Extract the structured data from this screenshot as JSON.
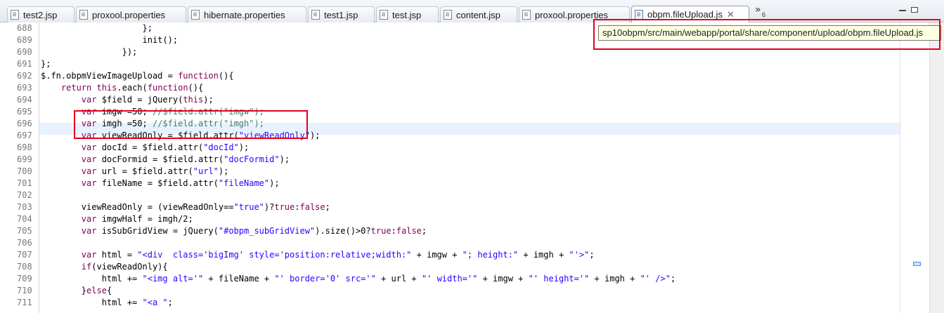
{
  "tabs": [
    {
      "label": "test2.jsp",
      "icon": "jsp-file-icon"
    },
    {
      "label": "proxool.properties",
      "icon": "properties-file-icon"
    },
    {
      "label": "hibernate.properties",
      "icon": "properties-file-icon"
    },
    {
      "label": "test1.jsp",
      "icon": "jsp-file-icon"
    },
    {
      "label": "test.jsp",
      "icon": "jsp-file-icon"
    },
    {
      "label": "content.jsp",
      "icon": "jsp-file-icon"
    },
    {
      "label": "proxool.properties",
      "icon": "properties-file-icon"
    },
    {
      "label": "obpm.fileUpload.js",
      "icon": "js-file-icon",
      "active": true,
      "close": "✕"
    }
  ],
  "tabs_overflow": {
    "chevron": "»",
    "count": "6"
  },
  "tooltip": {
    "text": "sp10obpm/src/main/webapp/portal/share/component/upload/obpm.fileUpload.js"
  },
  "editor": {
    "highlighted_line": "696",
    "lines": [
      {
        "num": "688",
        "segments": [
          {
            "t": "                    };",
            "c": "#000000"
          }
        ]
      },
      {
        "num": "689",
        "segments": [
          {
            "t": "                    init();",
            "c": "#000000"
          }
        ]
      },
      {
        "num": "690",
        "segments": [
          {
            "t": "                });",
            "c": "#000000"
          }
        ]
      },
      {
        "num": "691",
        "segments": [
          {
            "t": "};",
            "c": "#000000"
          }
        ]
      },
      {
        "num": "692",
        "segments": [
          {
            "t": "$.fn.obpmViewImageUpload = ",
            "c": "#000000"
          },
          {
            "t": "function",
            "c": "#7f0055"
          },
          {
            "t": "(){",
            "c": "#000000"
          }
        ]
      },
      {
        "num": "693",
        "segments": [
          {
            "t": "    ",
            "c": "#000000"
          },
          {
            "t": "return this",
            "c": "#7f0055"
          },
          {
            "t": ".each(",
            "c": "#000000"
          },
          {
            "t": "function",
            "c": "#7f0055"
          },
          {
            "t": "(){",
            "c": "#000000"
          }
        ]
      },
      {
        "num": "694",
        "segments": [
          {
            "t": "        ",
            "c": "#000000"
          },
          {
            "t": "var",
            "c": "#7f0055"
          },
          {
            "t": " $field = jQuery(",
            "c": "#000000"
          },
          {
            "t": "this",
            "c": "#7f0055"
          },
          {
            "t": ");",
            "c": "#000000"
          }
        ]
      },
      {
        "num": "695",
        "segments": [
          {
            "t": "        ",
            "c": "#000000"
          },
          {
            "t": "var",
            "c": "#7f0055"
          },
          {
            "t": " imgw =50; ",
            "c": "#000000"
          },
          {
            "t": "//$field.attr(\"imgw\");",
            "c": "#3f7f5f"
          }
        ]
      },
      {
        "num": "696",
        "segments": [
          {
            "t": "        ",
            "c": "#000000"
          },
          {
            "t": "var",
            "c": "#7f0055"
          },
          {
            "t": " imgh =50; ",
            "c": "#000000"
          },
          {
            "t": "//$field.attr(\"imgh\");",
            "c": "#3f7f5f"
          }
        ]
      },
      {
        "num": "697",
        "segments": [
          {
            "t": "        ",
            "c": "#000000"
          },
          {
            "t": "var",
            "c": "#7f0055"
          },
          {
            "t": " viewReadOnly = $field.attr(",
            "c": "#000000"
          },
          {
            "t": "\"viewReadOnly\"",
            "c": "#2a00ff"
          },
          {
            "t": ");",
            "c": "#000000"
          }
        ]
      },
      {
        "num": "698",
        "segments": [
          {
            "t": "        ",
            "c": "#000000"
          },
          {
            "t": "var",
            "c": "#7f0055"
          },
          {
            "t": " docId = $field.attr(",
            "c": "#000000"
          },
          {
            "t": "\"docId\"",
            "c": "#2a00ff"
          },
          {
            "t": ");",
            "c": "#000000"
          }
        ]
      },
      {
        "num": "699",
        "segments": [
          {
            "t": "        ",
            "c": "#000000"
          },
          {
            "t": "var",
            "c": "#7f0055"
          },
          {
            "t": " docFormid = $field.attr(",
            "c": "#000000"
          },
          {
            "t": "\"docFormid\"",
            "c": "#2a00ff"
          },
          {
            "t": ");",
            "c": "#000000"
          }
        ]
      },
      {
        "num": "700",
        "segments": [
          {
            "t": "        ",
            "c": "#000000"
          },
          {
            "t": "var",
            "c": "#7f0055"
          },
          {
            "t": " url = $field.attr(",
            "c": "#000000"
          },
          {
            "t": "\"url\"",
            "c": "#2a00ff"
          },
          {
            "t": ");",
            "c": "#000000"
          }
        ]
      },
      {
        "num": "701",
        "segments": [
          {
            "t": "        ",
            "c": "#000000"
          },
          {
            "t": "var",
            "c": "#7f0055"
          },
          {
            "t": " fileName = $field.attr(",
            "c": "#000000"
          },
          {
            "t": "\"fileName\"",
            "c": "#2a00ff"
          },
          {
            "t": ");",
            "c": "#000000"
          }
        ]
      },
      {
        "num": "702",
        "segments": []
      },
      {
        "num": "703",
        "segments": [
          {
            "t": "        viewReadOnly = (viewReadOnly==",
            "c": "#000000"
          },
          {
            "t": "\"true\"",
            "c": "#2a00ff"
          },
          {
            "t": ")?",
            "c": "#000000"
          },
          {
            "t": "true",
            "c": "#7f0055"
          },
          {
            "t": ":",
            "c": "#000000"
          },
          {
            "t": "false",
            "c": "#7f0055"
          },
          {
            "t": ";",
            "c": "#000000"
          }
        ]
      },
      {
        "num": "704",
        "segments": [
          {
            "t": "        ",
            "c": "#000000"
          },
          {
            "t": "var",
            "c": "#7f0055"
          },
          {
            "t": " imgwHalf = imgh/2;",
            "c": "#000000"
          }
        ]
      },
      {
        "num": "705",
        "segments": [
          {
            "t": "        ",
            "c": "#000000"
          },
          {
            "t": "var",
            "c": "#7f0055"
          },
          {
            "t": " isSubGridView = jQuery(",
            "c": "#000000"
          },
          {
            "t": "\"#obpm_subGridView\"",
            "c": "#2a00ff"
          },
          {
            "t": ").size()>0?",
            "c": "#000000"
          },
          {
            "t": "true",
            "c": "#7f0055"
          },
          {
            "t": ":",
            "c": "#000000"
          },
          {
            "t": "false",
            "c": "#7f0055"
          },
          {
            "t": ";",
            "c": "#000000"
          }
        ]
      },
      {
        "num": "706",
        "segments": []
      },
      {
        "num": "707",
        "segments": [
          {
            "t": "        ",
            "c": "#000000"
          },
          {
            "t": "var",
            "c": "#7f0055"
          },
          {
            "t": " html = ",
            "c": "#000000"
          },
          {
            "t": "\"<div  class='bigImg' style='position:relative;width:\"",
            "c": "#2a00ff"
          },
          {
            "t": " + imgw + ",
            "c": "#000000"
          },
          {
            "t": "\"; height:\"",
            "c": "#2a00ff"
          },
          {
            "t": " + imgh + ",
            "c": "#000000"
          },
          {
            "t": "\"'>\"",
            "c": "#2a00ff"
          },
          {
            "t": ";",
            "c": "#000000"
          }
        ]
      },
      {
        "num": "708",
        "segments": [
          {
            "t": "        ",
            "c": "#000000"
          },
          {
            "t": "if",
            "c": "#7f0055"
          },
          {
            "t": "(viewReadOnly){",
            "c": "#000000"
          }
        ]
      },
      {
        "num": "709",
        "segments": [
          {
            "t": "            html += ",
            "c": "#000000"
          },
          {
            "t": "\"<img alt='\"",
            "c": "#2a00ff"
          },
          {
            "t": " + fileName + ",
            "c": "#000000"
          },
          {
            "t": "\"' border='0' src='\"",
            "c": "#2a00ff"
          },
          {
            "t": " + url + ",
            "c": "#000000"
          },
          {
            "t": "\"' width='\"",
            "c": "#2a00ff"
          },
          {
            "t": " + imgw + ",
            "c": "#000000"
          },
          {
            "t": "\"' height='\"",
            "c": "#2a00ff"
          },
          {
            "t": " + imgh + ",
            "c": "#000000"
          },
          {
            "t": "\"' />\"",
            "c": "#2a00ff"
          },
          {
            "t": ";",
            "c": "#000000"
          }
        ]
      },
      {
        "num": "710",
        "segments": [
          {
            "t": "        }",
            "c": "#000000"
          },
          {
            "t": "else",
            "c": "#7f0055"
          },
          {
            "t": "{",
            "c": "#000000"
          }
        ]
      },
      {
        "num": "711",
        "segments": [
          {
            "t": "            html += ",
            "c": "#000000"
          },
          {
            "t": "\"<a \"",
            "c": "#2a00ff"
          },
          {
            "t": ";",
            "c": "#000000"
          }
        ]
      }
    ]
  },
  "colors": {
    "keyword": "#7f0055",
    "string": "#2a00ff",
    "comment": "#3f7f5f",
    "highlight_line": "#e8f2fe",
    "annotation_box": "#e3001b"
  }
}
